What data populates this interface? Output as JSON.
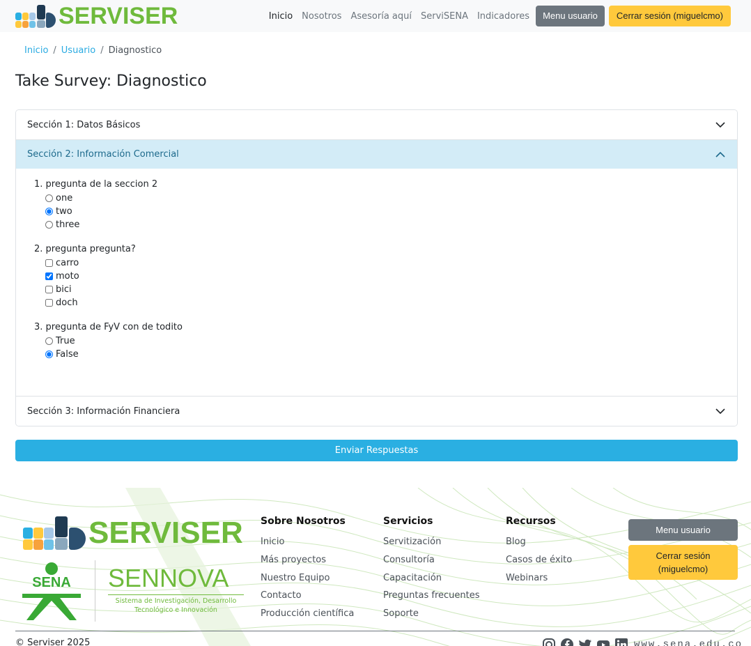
{
  "navbar": {
    "logo_text": "SERVISER",
    "links": [
      "Inicio",
      "Nosotros",
      "Asesoría aquí",
      "ServiSENA",
      "Indicadores"
    ],
    "user_menu": "Menu usuario",
    "logout": "Cerrar sesión (miguelcmo)"
  },
  "breadcrumb": {
    "items": [
      "Inicio",
      "Usuario"
    ],
    "current": "Diagnostico",
    "separator": "/"
  },
  "page_title": "Take Survey: Diagnostico",
  "sections": [
    {
      "title": "Sección 1: Datos Básicos",
      "expanded": false
    },
    {
      "title": "Sección 2: Información Comercial",
      "expanded": true
    },
    {
      "title": "Sección 3: Información Financiera",
      "expanded": false
    }
  ],
  "questions": [
    {
      "label": "1. pregunta de la seccion 2",
      "type": "radio",
      "options": [
        "one",
        "two",
        "three"
      ],
      "selected": [
        "two"
      ]
    },
    {
      "label": "2. pregunta pregunta?",
      "type": "checkbox",
      "options": [
        "carro",
        "moto",
        "bici",
        "doch"
      ],
      "selected": [
        "moto"
      ]
    },
    {
      "label": "3. pregunta de FyV con de todito",
      "type": "radio",
      "options": [
        "True",
        "False"
      ],
      "selected": [
        "False"
      ]
    }
  ],
  "submit_label": "Enviar Respuestas",
  "footer": {
    "logo_text": "SERVISER",
    "sena_text": "SENA",
    "sennova_text": "SENNOVA",
    "sennova_sub": "Sistema de Investigación, Desarrollo Tecnológico e Innovación",
    "columns": [
      {
        "title": "Sobre Nosotros",
        "links": [
          "Inicio",
          "Más proyectos",
          "Nuestro Equipo",
          "Contacto",
          "Producción científica"
        ]
      },
      {
        "title": "Servicios",
        "links": [
          "Servitización",
          "Consultoría",
          "Capacitación",
          "Preguntas frecuentes",
          "Soporte"
        ]
      },
      {
        "title": "Recursos",
        "links": [
          "Blog",
          "Casos de éxito",
          "Webinars"
        ]
      }
    ],
    "user_menu": "Menu usuario",
    "logout": "Cerrar sesión (miguelcmo)",
    "copyright": "© Serviser 2025",
    "social_icons": [
      "instagram-icon",
      "facebook-icon",
      "twitter-icon",
      "youtube-icon",
      "linkedin-icon"
    ],
    "url": "www.sena.edu.co"
  },
  "colors": {
    "brand_green": "#6fba3c",
    "accent_blue": "#2aafe2",
    "yellow": "#ffc93c",
    "gray": "#6c757d",
    "section_open_bg": "#d3ecf7"
  }
}
